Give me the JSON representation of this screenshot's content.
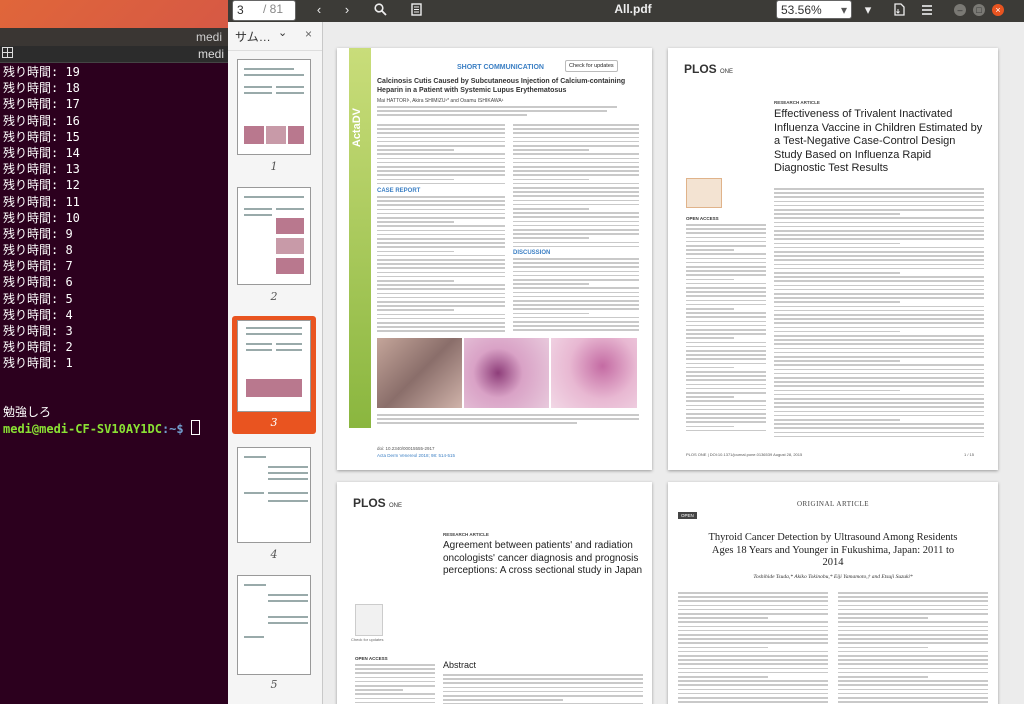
{
  "terminal": {
    "title": "medi",
    "tab_label": "medi",
    "countdown": [
      "残り時間: 19",
      "残り時間: 18",
      "残り時間: 17",
      "残り時間: 16",
      "残り時間: 15",
      "残り時間: 14",
      "残り時間: 13",
      "残り時間: 12",
      "残り時間: 11",
      "残り時間: 10",
      "残り時間: 9",
      "残り時間: 8",
      "残り時間: 7",
      "残り時間: 6",
      "残り時間: 5",
      "残り時間: 4",
      "残り時間: 3",
      "残り時間: 2",
      "残り時間: 1"
    ],
    "message": "勉強しろ",
    "prompt_user": "medi@medi-CF-SV10AY1DC",
    "prompt_path": ":~$"
  },
  "viewer": {
    "page_current": "3",
    "page_total": "/ 81",
    "title": "All.pdf",
    "zoom": "53.56%",
    "sidebar_label": "サム…",
    "thumbnails": [
      "1",
      "2",
      "3",
      "4",
      "5"
    ],
    "selected_thumbnail": 3
  },
  "pages": {
    "p3": {
      "journal_tag": "ActaDV",
      "section": "SHORT COMMUNICATION",
      "check_updates": "Check for updates",
      "title": "Calcinosis Cutis Caused by Subcutaneous Injection of Calcium-containing Heparin in a Patient with Systemic Lupus Erythematosus",
      "authors": "Mai HATTORI¹, Akira SHIMIZU¹* and Osamu ISHIKAWA¹",
      "case_report": "CASE REPORT",
      "discussion": "DISCUSSION",
      "footer_left": "doi: 10.2340/00015555-2917",
      "footer_right": "Acta Derm Venereol 2018; 98: 514-515"
    },
    "p4": {
      "journal": "PLOS",
      "journal_sub": "ONE",
      "section": "RESEARCH ARTICLE",
      "title": "Effectiveness of Trivalent Inactivated Influenza Vaccine in Children Estimated by a Test-Negative Case-Control Design Study Based on Influenza Rapid Diagnostic Test Results",
      "open_access": "OPEN ACCESS",
      "footer": "PLOS ONE | DOI:10.1371/journal.pone.0136539  August 28, 2015",
      "page_no": "1 / 15"
    },
    "p5": {
      "journal": "PLOS",
      "journal_sub": "ONE",
      "section": "RESEARCH ARTICLE",
      "title": "Agreement between patients' and radiation oncologists' cancer diagnosis and prognosis perceptions: A cross sectional study in Japan",
      "abstract": "Abstract",
      "open_access": "OPEN ACCESS",
      "check_updates": "Check for updates"
    },
    "p6": {
      "section": "ORIGINAL ARTICLE",
      "open": "OPEN",
      "title": "Thyroid Cancer Detection by Ultrasound Among Residents Ages 18 Years and Younger in Fukushima, Japan: 2011 to 2014",
      "authors": "Toshihide Tsuda,* Akiko Tokinobu,* Eiji Yamamoto,† and Etsuji Suzuki*"
    }
  }
}
